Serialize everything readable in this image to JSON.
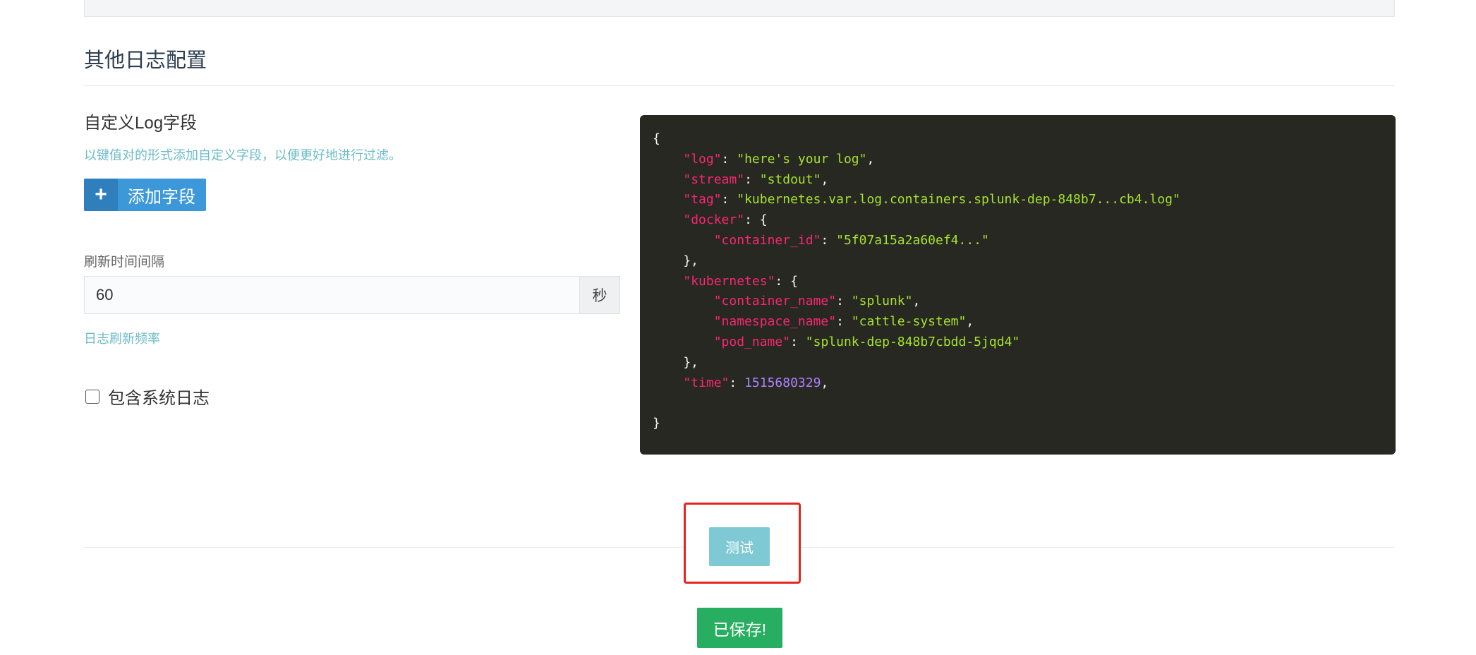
{
  "section": {
    "title": "其他日志配置"
  },
  "custom_fields": {
    "label": "自定义Log字段",
    "help": "以键值对的形式添加自定义字段，以便更好地进行过滤。",
    "add_button_icon": "+",
    "add_button_label": "添加字段"
  },
  "refresh": {
    "label": "刷新时间间隔",
    "value": "60",
    "unit": "秒",
    "help": "日志刷新频率"
  },
  "system_log": {
    "label": "包含系统日志",
    "checked": false
  },
  "sample_log": {
    "lines": [
      [
        {
          "t": "punc",
          "v": "{"
        }
      ],
      [
        {
          "t": "punc",
          "v": "    "
        },
        {
          "t": "key",
          "v": "\"log\""
        },
        {
          "t": "punc",
          "v": ": "
        },
        {
          "t": "str",
          "v": "\"here's your log\""
        },
        {
          "t": "punc",
          "v": ","
        }
      ],
      [
        {
          "t": "punc",
          "v": "    "
        },
        {
          "t": "key",
          "v": "\"stream\""
        },
        {
          "t": "punc",
          "v": ": "
        },
        {
          "t": "str",
          "v": "\"stdout\""
        },
        {
          "t": "punc",
          "v": ","
        }
      ],
      [
        {
          "t": "punc",
          "v": "    "
        },
        {
          "t": "key",
          "v": "\"tag\""
        },
        {
          "t": "punc",
          "v": ": "
        },
        {
          "t": "str",
          "v": "\"kubernetes.var.log.containers.splunk-dep-848b7...cb4.log\""
        }
      ],
      [
        {
          "t": "punc",
          "v": "    "
        },
        {
          "t": "key",
          "v": "\"docker\""
        },
        {
          "t": "punc",
          "v": ": {"
        }
      ],
      [
        {
          "t": "punc",
          "v": "        "
        },
        {
          "t": "key",
          "v": "\"container_id\""
        },
        {
          "t": "punc",
          "v": ": "
        },
        {
          "t": "str",
          "v": "\"5f07a15a2a60ef4...\""
        }
      ],
      [
        {
          "t": "punc",
          "v": "    },"
        }
      ],
      [
        {
          "t": "punc",
          "v": "    "
        },
        {
          "t": "key",
          "v": "\"kubernetes\""
        },
        {
          "t": "punc",
          "v": ": {"
        }
      ],
      [
        {
          "t": "punc",
          "v": "        "
        },
        {
          "t": "key",
          "v": "\"container_name\""
        },
        {
          "t": "punc",
          "v": ": "
        },
        {
          "t": "str",
          "v": "\"splunk\""
        },
        {
          "t": "punc",
          "v": ","
        }
      ],
      [
        {
          "t": "punc",
          "v": "        "
        },
        {
          "t": "key",
          "v": "\"namespace_name\""
        },
        {
          "t": "punc",
          "v": ": "
        },
        {
          "t": "str",
          "v": "\"cattle-system\""
        },
        {
          "t": "punc",
          "v": ","
        }
      ],
      [
        {
          "t": "punc",
          "v": "        "
        },
        {
          "t": "key",
          "v": "\"pod_name\""
        },
        {
          "t": "punc",
          "v": ": "
        },
        {
          "t": "str",
          "v": "\"splunk-dep-848b7cbdd-5jqd4\""
        }
      ],
      [
        {
          "t": "punc",
          "v": "    },"
        }
      ],
      [
        {
          "t": "punc",
          "v": "    "
        },
        {
          "t": "key",
          "v": "\"time\""
        },
        {
          "t": "punc",
          "v": ": "
        },
        {
          "t": "num",
          "v": "1515680329"
        },
        {
          "t": "punc",
          "v": ","
        }
      ],
      [
        {
          "t": "punc",
          "v": ""
        }
      ],
      [
        {
          "t": "punc",
          "v": "}"
        }
      ]
    ]
  },
  "actions": {
    "test_label": "测试",
    "saved_label": "已保存!"
  },
  "colors": {
    "accent_blue": "#3d98d9",
    "help_text": "#6dbcc9",
    "highlight_red": "#e5231f",
    "save_green": "#27ae60",
    "code_bg": "#272822"
  }
}
